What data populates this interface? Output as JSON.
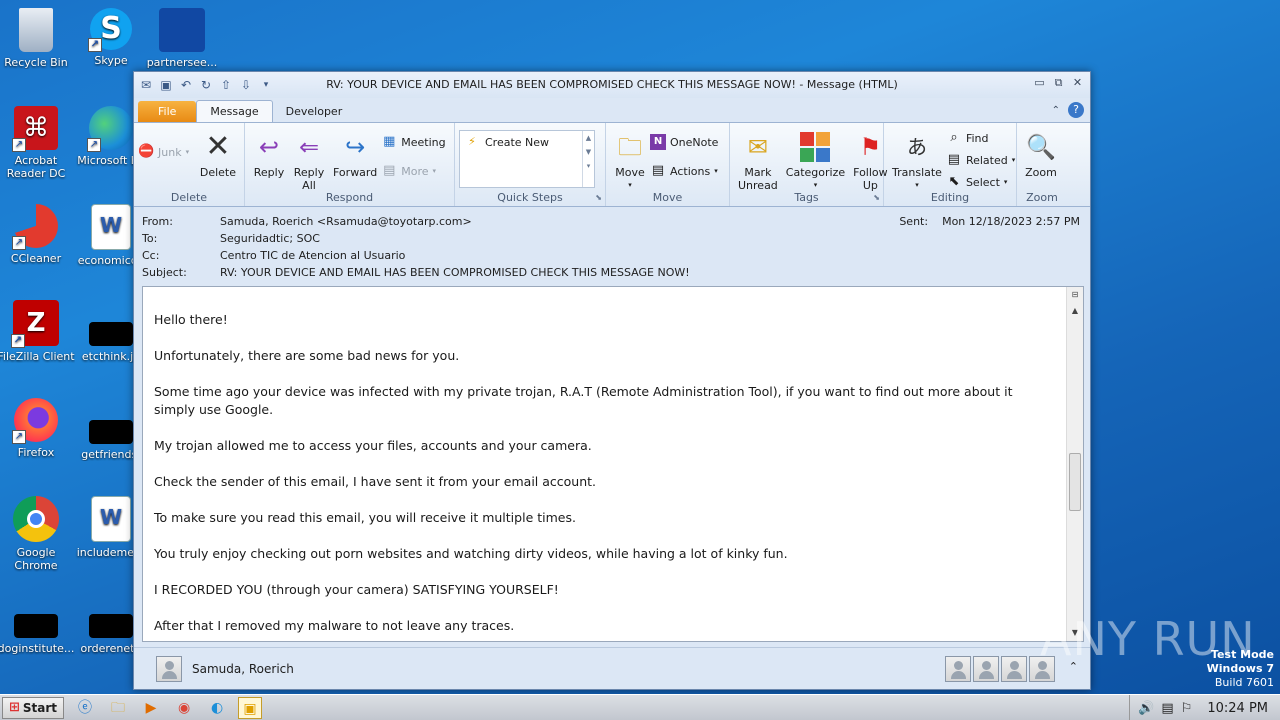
{
  "desktop": {
    "icons": [
      {
        "label": "Recycle Bin"
      },
      {
        "label": "Skype"
      },
      {
        "label": "partnersee..."
      },
      {
        "label": "Acrobat Reader DC"
      },
      {
        "label": "Microsoft Ed"
      },
      {
        "label": "CCleaner"
      },
      {
        "label": "economicdv"
      },
      {
        "label": "FileZilla Client"
      },
      {
        "label": "etcthink.jp"
      },
      {
        "label": "Firefox"
      },
      {
        "label": "getfriends."
      },
      {
        "label": "Google Chrome"
      },
      {
        "label": "includemeth"
      },
      {
        "label": "doginstitute..."
      },
      {
        "label": "orderenetg"
      }
    ],
    "watermark": "ANY RUN",
    "test_mode": {
      "line1": "Test Mode",
      "line2": "Windows 7",
      "line3": "Build 7601"
    }
  },
  "window": {
    "title": "RV: YOUR DEVICE AND EMAIL HAS BEEN COMPROMISED CHECK THIS MESSAGE NOW!  -  Message (HTML)",
    "tabs": [
      "File",
      "Message",
      "Developer"
    ],
    "active_tab": "Message",
    "accent_color": "#e88a14"
  },
  "ribbon": {
    "delete_group": {
      "junk": "Junk",
      "delete": "Delete",
      "label": "Delete"
    },
    "respond_group": {
      "reply": "Reply",
      "reply_all_1": "Reply",
      "reply_all_2": "All",
      "forward": "Forward",
      "meeting": "Meeting",
      "more": "More",
      "label": "Respond"
    },
    "quick_steps": {
      "create_new": "Create New",
      "label": "Quick Steps"
    },
    "move_group": {
      "move": "Move",
      "onenote": "OneNote",
      "actions": "Actions",
      "label": "Move"
    },
    "tags_group": {
      "mark_unread_1": "Mark",
      "mark_unread_2": "Unread",
      "categorize": "Categorize",
      "follow_up_1": "Follow",
      "follow_up_2": "Up",
      "label": "Tags"
    },
    "editing_group": {
      "translate": "Translate",
      "find": "Find",
      "related": "Related",
      "select": "Select",
      "label": "Editing"
    },
    "zoom_group": {
      "zoom": "Zoom",
      "label": "Zoom"
    }
  },
  "message": {
    "from_key": "From:",
    "from": "Samuda, Roerich <Rsamuda@toyotarp.com>",
    "to_key": "To:",
    "to": "Seguridadtic; SOC",
    "cc_key": "Cc:",
    "cc": "Centro TIC de Atencion al Usuario",
    "subject_key": "Subject:",
    "subject": "RV: YOUR DEVICE AND EMAIL HAS BEEN COMPROMISED CHECK THIS MESSAGE NOW!",
    "sent_key": "Sent:",
    "sent": "Mon 12/18/2023 2:57 PM",
    "body": [
      "Hello there!",
      "Unfortunately, there are some bad news for you.",
      "Some time ago your device was infected with my private trojan, R.A.T (Remote Administration Tool), if you want to find out more about it simply use Google.",
      "My trojan allowed me to access your files, accounts and your camera.",
      "Check the sender of this email, I have sent it from your email account.",
      "To make sure you read this email, you will receive it multiple times.",
      "You truly enjoy checking out porn websites and watching dirty videos, while having a lot of kinky fun.",
      "I RECORDED YOU (through your camera) SATISFYING YOURSELF!",
      "After that I removed my malware to not leave any traces."
    ]
  },
  "people_pane": {
    "name": "Samuda, Roerich"
  },
  "taskbar": {
    "start": "Start",
    "clock": "10:24 PM"
  }
}
